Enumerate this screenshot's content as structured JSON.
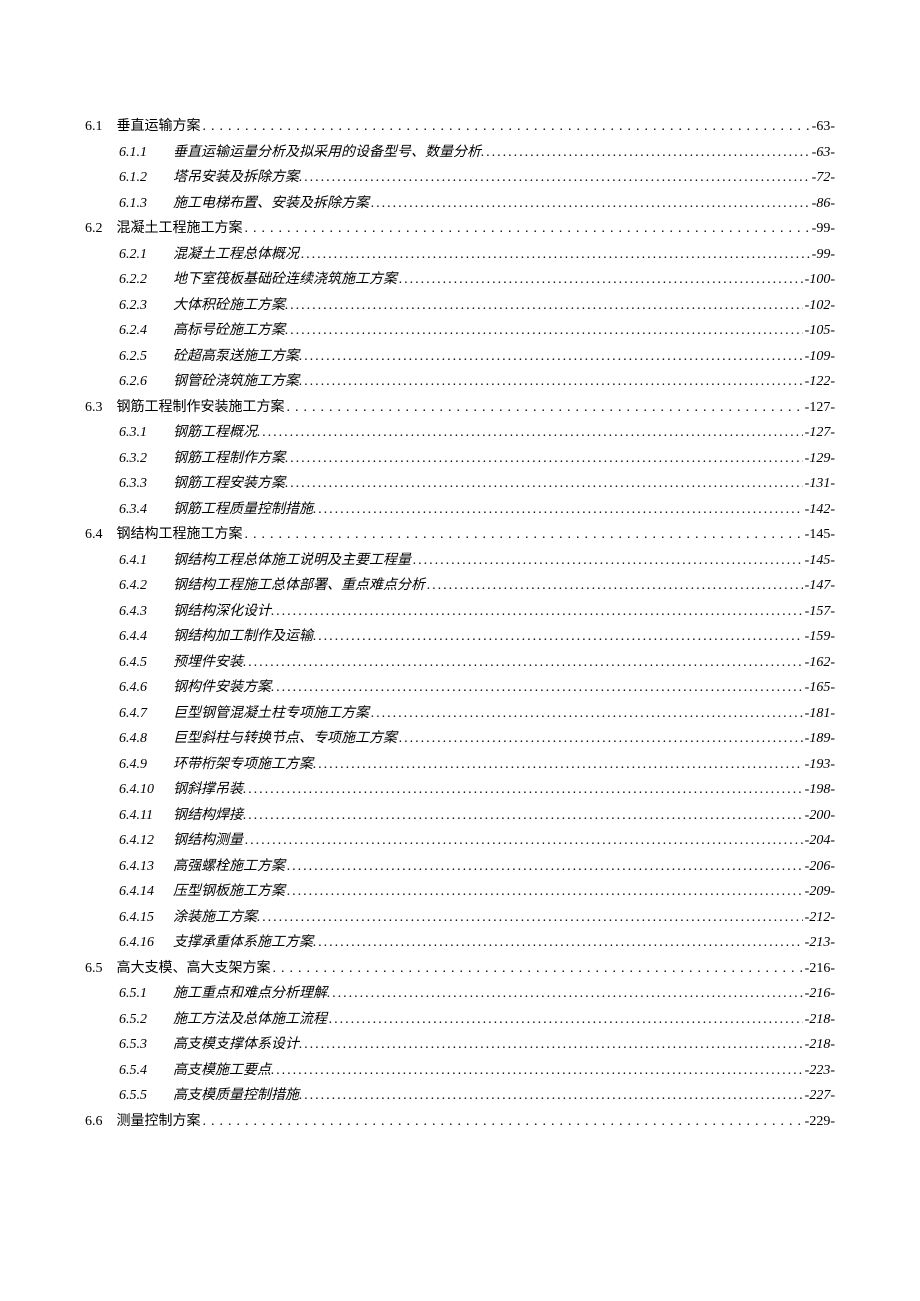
{
  "toc": [
    {
      "level": 1,
      "num": "6.1",
      "title": "垂直运输方案",
      "page": "-63-"
    },
    {
      "level": 2,
      "num": "6.1.1",
      "title": "垂直运输运量分析及拟采用的设备型号、数量分析.",
      "page": "-63-"
    },
    {
      "level": 2,
      "num": "6.1.2",
      "title": "塔吊安装及拆除方案.",
      "page": "-72-"
    },
    {
      "level": 2,
      "num": "6.1.3",
      "title": "施工电梯布置、安装及拆除方案",
      "page": "-86-"
    },
    {
      "level": 1,
      "num": "6.2",
      "title": "混凝土工程施工方案",
      "page": "-99-"
    },
    {
      "level": 2,
      "num": "6.2.1",
      "title": "混凝土工程总体概况",
      "page": "-99-"
    },
    {
      "level": 2,
      "num": "6.2.2",
      "title": "地下室筏板基础砼连续浇筑施工方案",
      "page": "-100-"
    },
    {
      "level": 2,
      "num": "6.2.3",
      "title": "大体积砼施工方案.",
      "page": "-102-"
    },
    {
      "level": 2,
      "num": "6.2.4",
      "title": "高标号砼施工方案.",
      "page": "-105-"
    },
    {
      "level": 2,
      "num": "6.2.5",
      "title": "砼超高泵送施工方案.",
      "page": "-109-"
    },
    {
      "level": 2,
      "num": "6.2.6",
      "title": "钢管砼浇筑施工方案.",
      "page": "-122-"
    },
    {
      "level": 1,
      "num": "6.3",
      "title": "钢筋工程制作安装施工方案",
      "page": "-127-"
    },
    {
      "level": 2,
      "num": "6.3.1",
      "title": "钢筋工程概况.",
      "page": "-127-"
    },
    {
      "level": 2,
      "num": "6.3.2",
      "title": "钢筋工程制作方案.",
      "page": "-129-"
    },
    {
      "level": 2,
      "num": "6.3.3",
      "title": "钢筋工程安装方案.",
      "page": "-131-"
    },
    {
      "level": 2,
      "num": "6.3.4",
      "title": "钢筋工程质量控制措施.",
      "page": "-142-"
    },
    {
      "level": 1,
      "num": "6.4",
      "title": "钢结构工程施工方案",
      "page": "-145-"
    },
    {
      "level": 2,
      "num": "6.4.1",
      "title": "钢结构工程总体施工说明及主要工程量",
      "page": "-145-"
    },
    {
      "level": 2,
      "num": "6.4.2",
      "title": "钢结构工程施工总体部署、重点难点分析",
      "page": "-147-"
    },
    {
      "level": 2,
      "num": "6.4.3",
      "title": "钢结构深化设计.",
      "page": "-157-"
    },
    {
      "level": 2,
      "num": "6.4.4",
      "title": "钢结构加工制作及运输.",
      "page": "-159-"
    },
    {
      "level": 2,
      "num": "6.4.5",
      "title": "预埋件安装.",
      "page": "-162-"
    },
    {
      "level": 2,
      "num": "6.4.6",
      "title": "钢构件安装方案.",
      "page": "-165-"
    },
    {
      "level": 2,
      "num": "6.4.7",
      "title": "巨型钢管混凝土柱专项施工方案",
      "page": "-181-"
    },
    {
      "level": 2,
      "num": "6.4.8",
      "title": "巨型斜柱与转换节点、专项施工方案",
      "page": "-189-"
    },
    {
      "level": 2,
      "num": "6.4.9",
      "title": "环带桁架专项施工方案.",
      "page": "-193-"
    },
    {
      "level": 2,
      "num": "6.4.10",
      "title": "钢斜撑吊装.",
      "page": "-198-"
    },
    {
      "level": 2,
      "num": "6.4.11",
      "title": "钢结构焊接.",
      "page": "-200-"
    },
    {
      "level": 2,
      "num": "6.4.12",
      "title": "钢结构测量",
      "page": "-204-"
    },
    {
      "level": 2,
      "num": "6.4.13",
      "title": "高强螺栓施工方案",
      "page": "-206-"
    },
    {
      "level": 2,
      "num": "6.4.14",
      "title": "压型钢板施工方案",
      "page": "-209-"
    },
    {
      "level": 2,
      "num": "6.4.15",
      "title": "涂装施工方案.",
      "page": "-212-"
    },
    {
      "level": 2,
      "num": "6.4.16",
      "title": "支撑承重体系施工方案.",
      "page": "-213-"
    },
    {
      "level": 1,
      "num": "6.5",
      "title": "高大支模、高大支架方案",
      "page": "-216-"
    },
    {
      "level": 2,
      "num": "6.5.1",
      "title": "施工重点和难点分析理解.",
      "page": "-216-"
    },
    {
      "level": 2,
      "num": "6.5.2",
      "title": "施工方法及总体施工流程",
      "page": "-218-"
    },
    {
      "level": 2,
      "num": "6.5.3",
      "title": "高支模支撑体系设计.",
      "page": "-218-"
    },
    {
      "level": 2,
      "num": "6.5.4",
      "title": "高支模施工要点.",
      "page": "-223-"
    },
    {
      "level": 2,
      "num": "6.5.5",
      "title": "高支模质量控制措施.",
      "page": "-227-"
    },
    {
      "level": 1,
      "num": "6.6",
      "title": "测量控制方案",
      "page": "-229-"
    }
  ]
}
